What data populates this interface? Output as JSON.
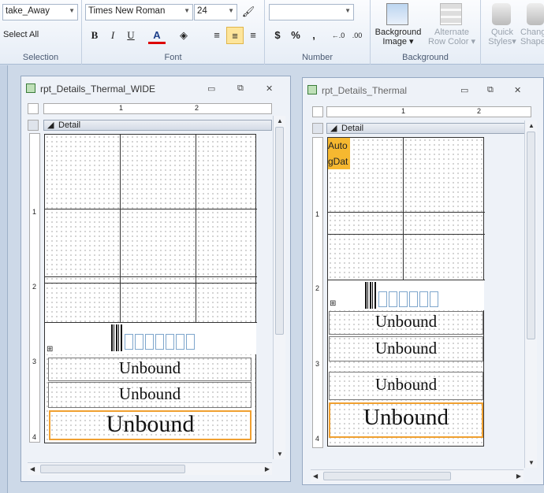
{
  "ribbon": {
    "selection": {
      "combo_value": "take_Away",
      "select_all": "Select All",
      "group_label": "Selection"
    },
    "font": {
      "font_name": "Times New Roman",
      "font_size": "24",
      "bold": "B",
      "italic": "I",
      "underline": "U",
      "group_label": "Font"
    },
    "number": {
      "format_value": "",
      "currency": "$",
      "percent": "%",
      "comma": ",",
      "group_label": "Number"
    },
    "background": {
      "bg_image_l1": "Background",
      "bg_image_l2": "Image",
      "alt_row_l1": "Alternate",
      "alt_row_l2": "Row Color",
      "group_label": "Background"
    },
    "styles": {
      "quick_l1": "Quick",
      "quick_l2": "Styles",
      "change_l1": "Chang",
      "change_l2": "Shape"
    }
  },
  "windows": [
    {
      "title": "rpt_Details_Thermal_WIDE",
      "section": "Detail",
      "unbound": [
        "Unbound",
        "Unbound",
        "Unbound"
      ],
      "ruler_h": [
        "1",
        "2"
      ],
      "ruler_v": [
        "1",
        "2",
        "3",
        "4"
      ]
    },
    {
      "title": "rpt_Details_Thermal",
      "section": "Detail",
      "unbound": [
        "Unbound",
        "Unbound",
        "Unbound",
        "Unbound"
      ],
      "fields": [
        "Auto",
        "gDat"
      ],
      "ruler_h": [
        "1",
        "2"
      ],
      "ruler_v": [
        "1",
        "2",
        "3",
        "4"
      ]
    }
  ],
  "colors": {
    "accent": "#f0a030",
    "field": "#f6b830",
    "ribbon_bg": "#e6edf6"
  }
}
